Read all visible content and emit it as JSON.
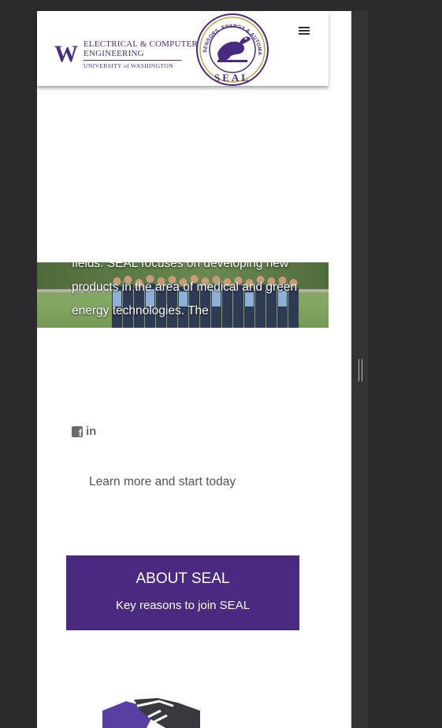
{
  "header": {
    "uw_logo": {
      "mark": "W",
      "line1": "ELECTRICAL & COMPUTER",
      "line2": "ENGINEERING",
      "line3": "UNIVERSITY of WASHINGTON"
    },
    "seal_logo": {
      "ring_text": "SENSORS, ENERGY & AUTOMATION LABORATORY",
      "name": "SEAL"
    },
    "menu_icon": "hamburger-menu-icon"
  },
  "hero": {
    "text": "fields. SEAL focuses on developing new products in the area of medical and green energy technologies. The"
  },
  "social": {
    "icons": [
      "facebook-icon",
      "linkedin-icon"
    ],
    "linkedin_label": "in"
  },
  "cta": {
    "learn_more": "Learn more and start today"
  },
  "about": {
    "title": "ABOUT SEAL",
    "subtitle": "Key reasons to join SEAL"
  },
  "colors": {
    "brand_purple": "#4a2a80",
    "uw_purple": "#4b2e83",
    "background_dark": "#2b2b2e",
    "text_gray": "#555555"
  }
}
